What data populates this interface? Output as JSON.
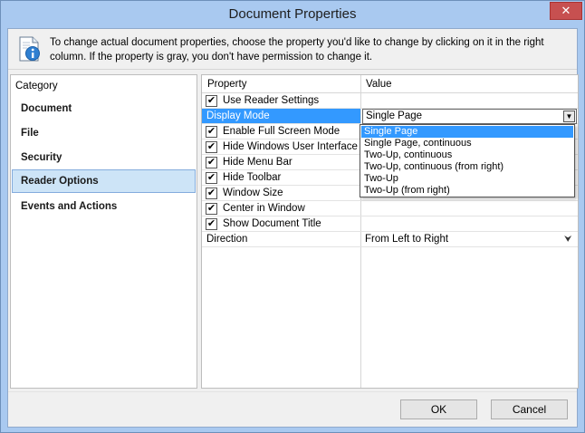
{
  "window": {
    "title": "Document Properties",
    "close_glyph": "✕"
  },
  "info": {
    "icon": "document-info-icon",
    "text": "To change actual document properties, choose the property you'd like to change by clicking on it in the right column. If the property is gray, you don't have permission to change it."
  },
  "category": {
    "header": "Category",
    "items": [
      {
        "label": "Document"
      },
      {
        "label": "File"
      },
      {
        "label": "Security"
      },
      {
        "label": "Reader Options"
      },
      {
        "label": "Events and Actions"
      }
    ],
    "selected": "Reader Options"
  },
  "grid": {
    "col_property": "Property",
    "col_value": "Value",
    "rows": [
      {
        "label": "Use Reader Settings",
        "checked": true,
        "check_glyph": "✔"
      },
      {
        "label": "Display Mode",
        "value": "Single Page",
        "highlighted": true
      },
      {
        "label": "Enable Full Screen Mode",
        "checked": true,
        "check_glyph": "✔"
      },
      {
        "label": "Hide Windows User Interface",
        "checked": true,
        "check_glyph": "✔"
      },
      {
        "label": "Hide Menu Bar",
        "checked": true,
        "check_glyph": "✔"
      },
      {
        "label": "Hide Toolbar",
        "checked": true,
        "check_glyph": "✔"
      },
      {
        "label": "Window Size",
        "checked": true,
        "check_glyph": "✔"
      },
      {
        "label": "Center in Window",
        "checked": true,
        "check_glyph": "✔"
      },
      {
        "label": "Show Document Title",
        "checked": true,
        "check_glyph": "✔"
      },
      {
        "label": "Direction",
        "value": "From Left to Right",
        "dropdown_glyph": "⮟"
      }
    ]
  },
  "display_mode_dropdown": {
    "arrow_glyph": "▼",
    "options": [
      "Single Page",
      "Single Page, continuous",
      "Two-Up, continuous",
      "Two-Up, continuous (from right)",
      "Two-Up",
      "Two-Up (from right)"
    ],
    "selected": "Single Page"
  },
  "buttons": {
    "ok": "OK",
    "cancel": "Cancel"
  },
  "colors": {
    "titlebar": "#a9c9f0",
    "selection": "#3399ff",
    "category_selection": "#cde4f7",
    "close": "#c75050"
  }
}
